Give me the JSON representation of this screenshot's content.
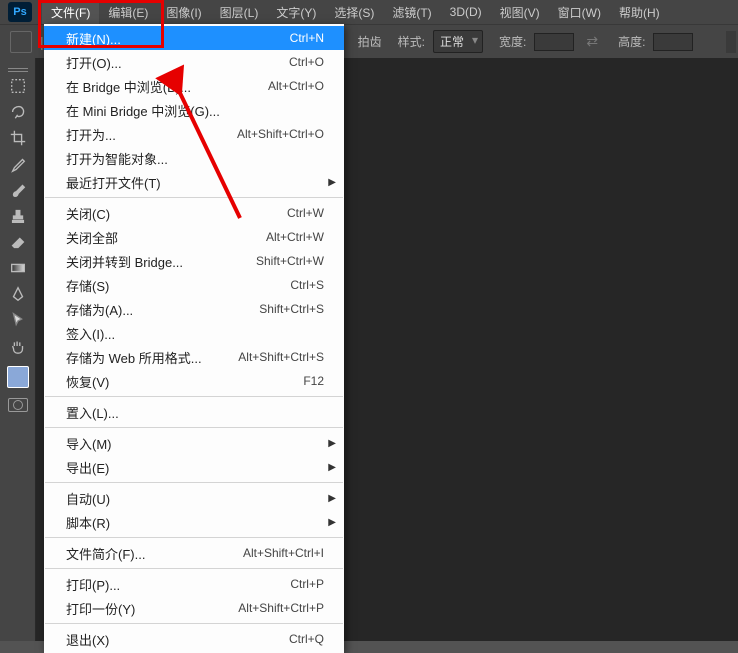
{
  "menubar": {
    "items": [
      {
        "label": "文件(F)"
      },
      {
        "label": "编辑(E)"
      },
      {
        "label": "图像(I)"
      },
      {
        "label": "图层(L)"
      },
      {
        "label": "文字(Y)"
      },
      {
        "label": "选择(S)"
      },
      {
        "label": "滤镜(T)"
      },
      {
        "label": "3D(D)"
      },
      {
        "label": "视图(V)"
      },
      {
        "label": "窗口(W)"
      },
      {
        "label": "帮助(H)"
      }
    ]
  },
  "options": {
    "snap_label": "拍齿",
    "style_label": "样式:",
    "style_value": "正常",
    "width_label": "宽度:",
    "height_label": "高度:"
  },
  "dropdown": {
    "items": [
      {
        "label": "新建(N)...",
        "shortcut": "Ctrl+N",
        "hl": true
      },
      {
        "label": "打开(O)...",
        "shortcut": "Ctrl+O"
      },
      {
        "label": "在 Bridge 中浏览(B)...",
        "shortcut": "Alt+Ctrl+O"
      },
      {
        "label": "在 Mini Bridge 中浏览(G)...",
        "shortcut": ""
      },
      {
        "label": "打开为...",
        "shortcut": "Alt+Shift+Ctrl+O"
      },
      {
        "label": "打开为智能对象...",
        "shortcut": ""
      },
      {
        "label": "最近打开文件(T)",
        "shortcut": "",
        "sub": true
      },
      {
        "sep": true
      },
      {
        "label": "关闭(C)",
        "shortcut": "Ctrl+W"
      },
      {
        "label": "关闭全部",
        "shortcut": "Alt+Ctrl+W"
      },
      {
        "label": "关闭并转到 Bridge...",
        "shortcut": "Shift+Ctrl+W"
      },
      {
        "label": "存储(S)",
        "shortcut": "Ctrl+S"
      },
      {
        "label": "存储为(A)...",
        "shortcut": "Shift+Ctrl+S"
      },
      {
        "label": "签入(I)...",
        "shortcut": ""
      },
      {
        "label": "存储为 Web 所用格式...",
        "shortcut": "Alt+Shift+Ctrl+S"
      },
      {
        "label": "恢复(V)",
        "shortcut": "F12"
      },
      {
        "sep": true
      },
      {
        "label": "置入(L)...",
        "shortcut": ""
      },
      {
        "sep": true
      },
      {
        "label": "导入(M)",
        "shortcut": "",
        "sub": true
      },
      {
        "label": "导出(E)",
        "shortcut": "",
        "sub": true
      },
      {
        "sep": true
      },
      {
        "label": "自动(U)",
        "shortcut": "",
        "sub": true
      },
      {
        "label": "脚本(R)",
        "shortcut": "",
        "sub": true
      },
      {
        "sep": true
      },
      {
        "label": "文件简介(F)...",
        "shortcut": "Alt+Shift+Ctrl+I"
      },
      {
        "sep": true
      },
      {
        "label": "打印(P)...",
        "shortcut": "Ctrl+P"
      },
      {
        "label": "打印一份(Y)",
        "shortcut": "Alt+Shift+Ctrl+P"
      },
      {
        "sep": true
      },
      {
        "label": "退出(X)",
        "shortcut": "Ctrl+Q"
      }
    ]
  }
}
